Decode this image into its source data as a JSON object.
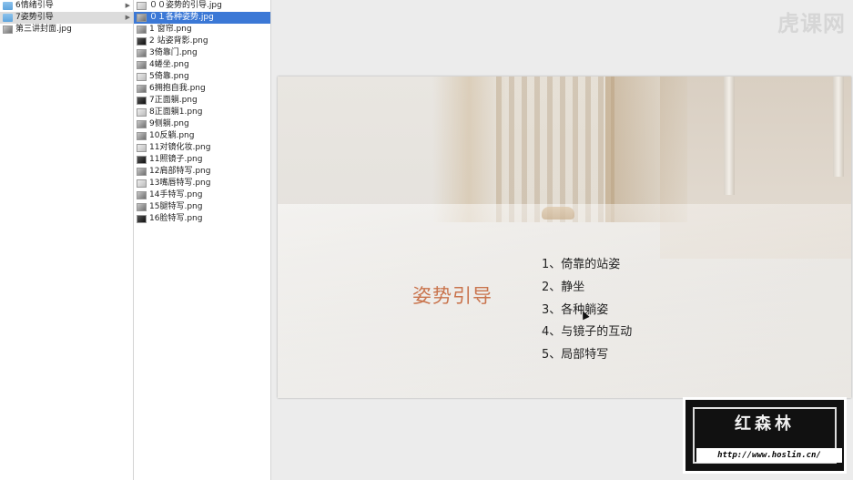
{
  "column1": {
    "items": [
      {
        "label": "6情绪引导",
        "icon": "folder-icon",
        "selected": false,
        "has_arrow": true
      },
      {
        "label": "7姿势引导",
        "icon": "folder-icon",
        "selected": true,
        "has_arrow": true
      },
      {
        "label": "第三讲封面.jpg",
        "icon": "image-icon",
        "selected": false,
        "has_arrow": false
      }
    ]
  },
  "column2": {
    "items": [
      {
        "label": "００姿势的引导.jpg",
        "icon": "image-icon"
      },
      {
        "label": "０１各种姿势.jpg",
        "icon": "image-icon",
        "selected": true
      },
      {
        "label": "1 窗帘.png",
        "icon": "image-icon"
      },
      {
        "label": "2 站姿背影.png",
        "icon": "image-icon"
      },
      {
        "label": "3倚靠门.png",
        "icon": "image-icon"
      },
      {
        "label": "4蜷坐.png",
        "icon": "image-icon"
      },
      {
        "label": "5倚靠.png",
        "icon": "image-icon"
      },
      {
        "label": "6拥抱自我.png",
        "icon": "image-icon"
      },
      {
        "label": "7正面躺.png",
        "icon": "image-icon"
      },
      {
        "label": "8正面躺1.png",
        "icon": "image-icon"
      },
      {
        "label": "9侧躺.png",
        "icon": "image-icon"
      },
      {
        "label": "10反躺.png",
        "icon": "image-icon"
      },
      {
        "label": "11对镜化妆.png",
        "icon": "image-icon"
      },
      {
        "label": "11照镜子.png",
        "icon": "image-icon"
      },
      {
        "label": "12肩部特写.png",
        "icon": "image-icon"
      },
      {
        "label": "13嘴唇特写.png",
        "icon": "image-icon"
      },
      {
        "label": "14手特写.png",
        "icon": "image-icon"
      },
      {
        "label": "15腿特写.png",
        "icon": "image-icon"
      },
      {
        "label": "16脸特写.png",
        "icon": "image-icon"
      }
    ]
  },
  "watermark": {
    "text": "虎课网"
  },
  "slide": {
    "title": "姿势引导",
    "title_color": "#c9744d",
    "list": [
      "1、倚靠的站姿",
      "2、静坐",
      "3、各种躺姿",
      "4、与镜子的互动",
      "5、局部特写"
    ]
  },
  "logo": {
    "name": "红森林",
    "url": "http://www.hoslin.cn/"
  }
}
